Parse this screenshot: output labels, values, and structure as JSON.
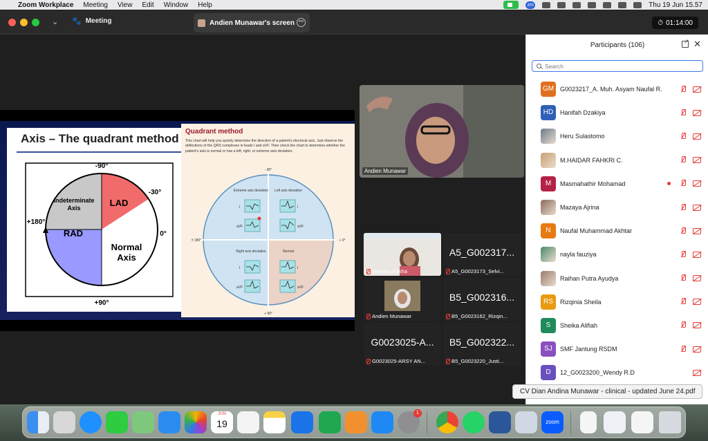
{
  "menubar": {
    "app_name": "Zoom Workplace",
    "menus": [
      "Meeting",
      "View",
      "Edit",
      "Window",
      "Help"
    ],
    "zoom_badge": "zm",
    "datetime": "Thu 19 Jun  15.57"
  },
  "titlebar": {
    "meeting_label": "Meeting",
    "screen_tab_label": "Andien Munawar's screen",
    "timer": "01:14:00"
  },
  "slide": {
    "title": "Axis – The quadrant method",
    "labels": {
      "m90": "-90°",
      "m30": "-30°",
      "p180": "+180°",
      "zero": "0°",
      "p90": "+90°",
      "lad": "LAD",
      "indeterminate": "Indeterminate Axis",
      "normal": "Normal Axis",
      "rad": "RAD"
    },
    "qm_title": "Quadrant method",
    "qm_body": "This chart will help you quickly determine the direction of a patient's electrical axis. Just observe the deflections of the QRS complexes in leads I and aVF. Then check the chart to determine whether the patient's axis is normal or has a left, right, or extreme axis deviation.",
    "qm_quadrants": {
      "tl": "Extreme axis deviation",
      "tr": "Left axis deviation",
      "bl": "Right axis deviation",
      "br": "Normal"
    },
    "qm_axis": {
      "top": "- 90°",
      "bottom": "+ 90°",
      "left": "± 180°",
      "right": "+ 0°"
    },
    "qm_leads": {
      "lead_i": "I",
      "lead_avf": "aVF"
    }
  },
  "speaker": {
    "name": "Andien Munawar"
  },
  "gallery": [
    {
      "big": "",
      "small": "Dyonisa Pakha",
      "has_video": true
    },
    {
      "big": "A5_G002317...",
      "small": "A5_G0023173_Selvi...",
      "has_video": false
    },
    {
      "big": "",
      "small": "Andien Munawar",
      "has_video": true
    },
    {
      "big": "B5_G002316...",
      "small": "B5_G0023162_Rizqin...",
      "has_video": false
    },
    {
      "big": "G0023025-A...",
      "small": "G0023025-ARSY AN...",
      "has_video": false
    },
    {
      "big": "B5_G002322...",
      "small": "B5_G0023220_Justi...",
      "has_video": false
    }
  ],
  "participants": {
    "title": "Participants (106)",
    "search_placeholder": "Search",
    "list": [
      {
        "initials": "GM",
        "color": "#e07020",
        "name": "G0023217_A. Muh. Asyam Naufal R.",
        "photo": false,
        "dot": false
      },
      {
        "initials": "HD",
        "color": "#2f5fb8",
        "name": "Hanifah Dzakiya",
        "photo": false,
        "dot": false
      },
      {
        "initials": "",
        "color": "#6b7a8c",
        "name": "Heru Sulastomo",
        "photo": true,
        "dot": false
      },
      {
        "initials": "",
        "color": "#c9a070",
        "name": "M.HAIDAR FAHKRI C.",
        "photo": true,
        "dot": false
      },
      {
        "initials": "M",
        "color": "#b52047",
        "name": "Masmahathir Mohamad",
        "photo": false,
        "dot": true
      },
      {
        "initials": "",
        "color": "#8a6a5a",
        "name": "Mazaya Ajrina",
        "photo": true,
        "dot": false
      },
      {
        "initials": "N",
        "color": "#e87a12",
        "name": "Naufal Muhammad Akhtar",
        "photo": false,
        "dot": false
      },
      {
        "initials": "",
        "color": "#4a8a6a",
        "name": "nayla fauziya",
        "photo": true,
        "dot": false
      },
      {
        "initials": "",
        "color": "#9a7a6a",
        "name": "Raihan Putra Ayudya",
        "photo": true,
        "dot": false
      },
      {
        "initials": "RS",
        "color": "#e89a10",
        "name": "Rizqinia Sheila",
        "photo": false,
        "dot": false
      },
      {
        "initials": "S",
        "color": "#1f8a5a",
        "name": "Sheika Alifiah",
        "photo": false,
        "dot": false
      },
      {
        "initials": "SJ",
        "color": "#8a4fbf",
        "name": "SMF Jantung RSDM",
        "photo": false,
        "dot": false
      },
      {
        "initials": "D",
        "color": "#6a4fbf",
        "name": "12_G0023200_Wendy R.D",
        "photo": false,
        "dot": false
      }
    ]
  },
  "tooltip": "CV Dian Andina Munawar - clinical - updated June 24.pdf",
  "dock": {
    "calendar_month": "JUN",
    "calendar_day": "19",
    "settings_badge": "1",
    "zoom_label": "zoom",
    "icons": [
      "finder",
      "launchpad",
      "safari",
      "messages",
      "maps",
      "mail",
      "photos",
      "calendar",
      "reminders",
      "notes",
      "keynote",
      "numbers",
      "pages",
      "app-store",
      "system-settings",
      "chrome",
      "whatsapp",
      "word",
      "preview",
      "zoom",
      "document",
      "document",
      "document",
      "trash"
    ]
  }
}
